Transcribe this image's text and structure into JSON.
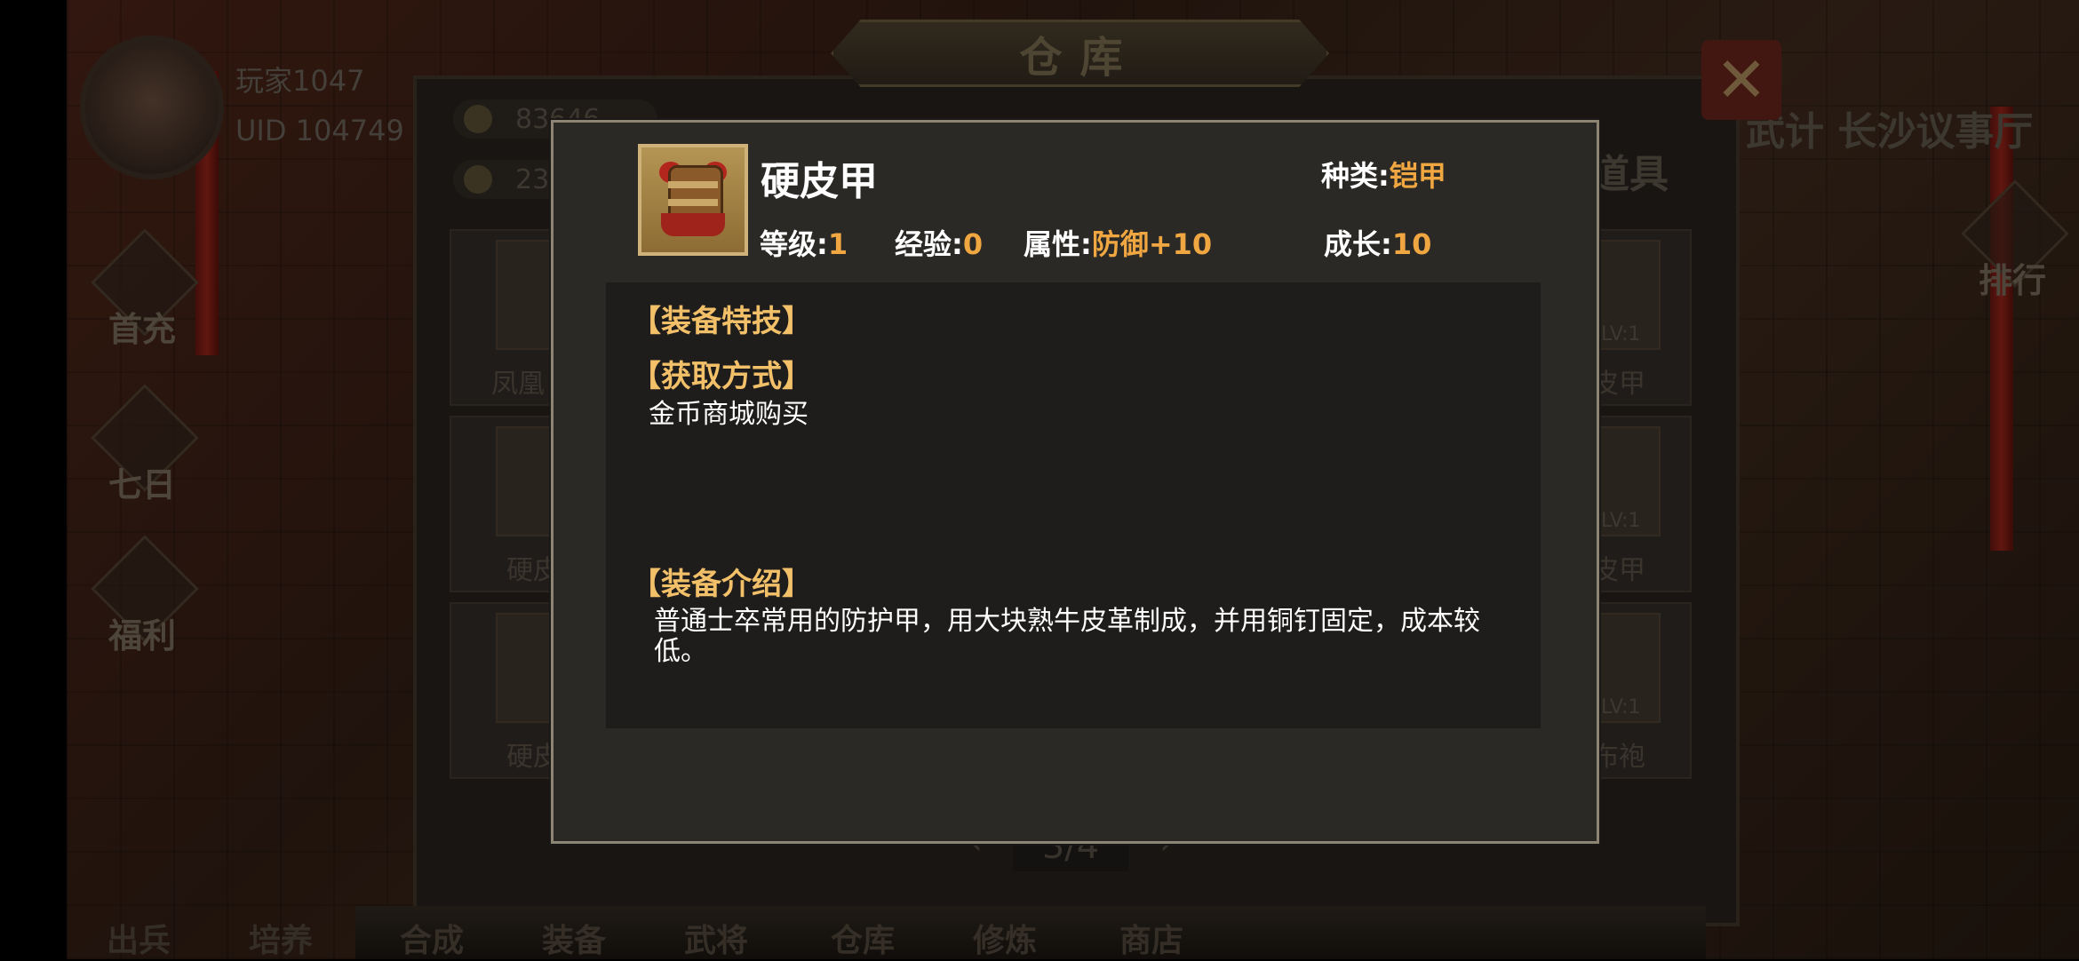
{
  "hud": {
    "player_name": "玩家1047",
    "uid": "UID 104749"
  },
  "side_menu": [
    "首充",
    "七日",
    "福利"
  ],
  "right_menu": {
    "rank": "排行",
    "location": "武计 长沙议事厅"
  },
  "warehouse": {
    "title": "仓库",
    "tab_label": "道具",
    "coins": "83646",
    "ingots": "23",
    "slots_left": [
      "凤凰",
      "硬皮",
      "硬皮"
    ],
    "slots_right": [
      "皮甲",
      "皮甲",
      "布袍"
    ],
    "level_badge": "LV:1",
    "page": "3/4"
  },
  "bottom_tabs": [
    "出兵",
    "培养",
    "合成",
    "装备",
    "武将",
    "仓库",
    "修炼",
    "商店"
  ],
  "item": {
    "name": "硬皮甲",
    "icon": "armor-icon",
    "type_label": "种类:",
    "type_value": "铠甲",
    "level_label": "等级:",
    "level_value": "1",
    "exp_label": "经验:",
    "exp_value": "0",
    "attr_label": "属性:",
    "attr_value": "防御+10",
    "growth_label": "成长:",
    "growth_value": "10",
    "section_skill": "【装备特技】",
    "section_obtain": "【获取方式】",
    "obtain_text": "金币商城购买",
    "section_intro": "【装备介绍】",
    "intro_text": "普通士卒常用的防护甲，用大块熟牛皮革制成，并用铜钉固定，成本较低。"
  },
  "colors": {
    "value_orange": "#f0a742",
    "section_gold": "#f3c06a",
    "dialog_bg": "#2b2926"
  }
}
